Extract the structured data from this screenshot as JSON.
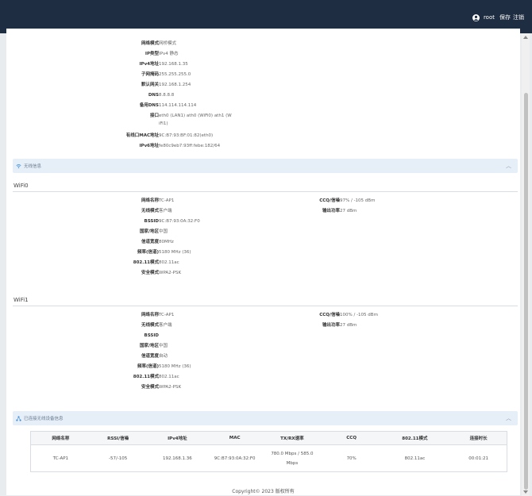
{
  "header": {
    "user": "root",
    "save": "保存",
    "logout": "注销"
  },
  "network": {
    "rows": [
      {
        "label": "网络模式",
        "value": "网桥模式"
      },
      {
        "label": "IP类型",
        "value": "IPv4 静态"
      },
      {
        "label": "IPv4地址",
        "value": "192.168.1.35"
      },
      {
        "label": "子网掩码",
        "value": "255.255.255.0"
      },
      {
        "label": "默认网关",
        "value": "192.168.1.254"
      },
      {
        "label": "DNS",
        "value": "8.8.8.8"
      },
      {
        "label": "备用DNS",
        "value": "114.114.114.114"
      },
      {
        "label": "接口",
        "value": "eth0 (LAN1)   ath0 (WiFi0)   ath1 (W",
        "value2": "iFi1)"
      },
      {
        "label": "有线口MAC地址",
        "value": "9C:B7:93:BF:01:82(eth0)"
      },
      {
        "label": "IPv6地址",
        "value": "fe80c9eb7:93ff:febe:182/64"
      }
    ]
  },
  "wireless_section": {
    "title": "无线信息"
  },
  "wifi0": {
    "title": "WiFi0",
    "left": [
      {
        "label": "网络名称",
        "value": "TC-AP1"
      },
      {
        "label": "无线模式",
        "value": "客户端"
      },
      {
        "label": "BSSID",
        "value": "9C:B7:93:0A:32:F0"
      },
      {
        "label": "国家/地区",
        "value": "中国"
      },
      {
        "label": "信道宽度",
        "value": "80MHz"
      },
      {
        "label": "频率(信道)",
        "value": "5180 MHz (36)"
      },
      {
        "label": "802.11模式",
        "value": "802.11ac"
      },
      {
        "label": "安全模式",
        "value": "WPA2-PSK"
      }
    ],
    "right": [
      {
        "label": "CCQ/信噪",
        "value": "97% / -105 dBm"
      },
      {
        "label": "输出功率",
        "value": "27 dBm"
      }
    ]
  },
  "wifi1": {
    "title": "WiFi1",
    "left": [
      {
        "label": "网络名称",
        "value": "TC-AP1"
      },
      {
        "label": "无线模式",
        "value": "客户端"
      },
      {
        "label": "BSSID",
        "value": ""
      },
      {
        "label": "国家/地区",
        "value": "中国"
      },
      {
        "label": "信道宽度",
        "value": "自动"
      },
      {
        "label": "频率(信道)",
        "value": "5180 MHz (36)"
      },
      {
        "label": "802.11模式",
        "value": "802.11ac"
      },
      {
        "label": "安全模式",
        "value": "WPA2-PSK"
      }
    ],
    "right": [
      {
        "label": "CCQ/信噪",
        "value": "100% / -105 dBm"
      },
      {
        "label": "输出功率",
        "value": "27 dBm"
      }
    ]
  },
  "connected_section": {
    "title": "已连接无线设备信息"
  },
  "devices_table": {
    "headers": [
      "网络名称",
      "RSSI/信噪",
      "IPv4地址",
      "MAC",
      "TX/RX速率",
      "CCQ",
      "802.11模式",
      "连接时长"
    ],
    "rows": [
      [
        "TC-AP1",
        "-57/-105",
        "192.168.1.36",
        "9C:B7:93:0A:32:F0",
        "780.0 Mbps / 585.0 Mbps",
        "70%",
        "802.11ac",
        "00:01:21"
      ]
    ]
  },
  "footer": {
    "copyright": "Copyright© 2023 版权所有"
  },
  "colors": {
    "topbar": "#1f2d42",
    "section_bar": "#e6eef7"
  }
}
